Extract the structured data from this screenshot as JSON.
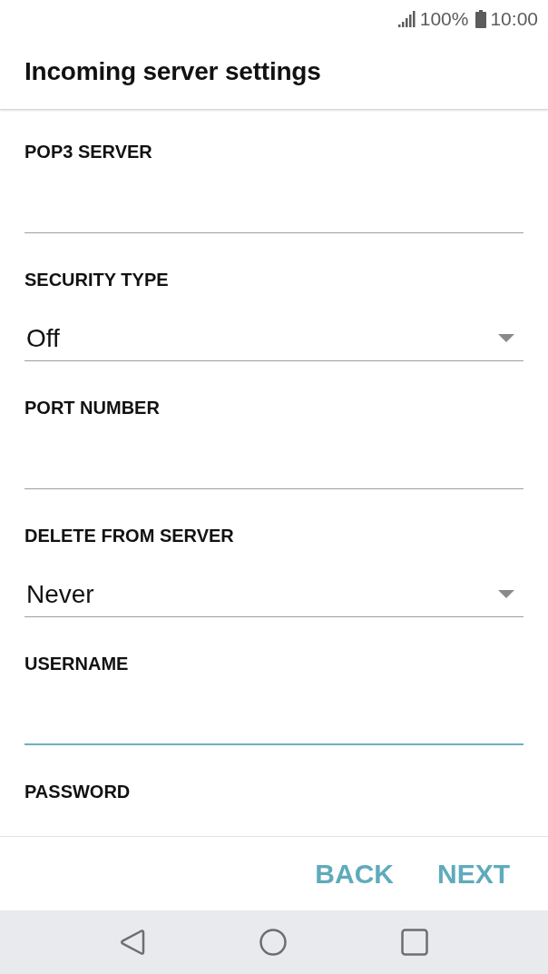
{
  "status_bar": {
    "battery_text": "100%",
    "time": "10:00"
  },
  "header": {
    "title": "Incoming server settings"
  },
  "fields": [
    {
      "kind": "text",
      "label": "POP3 SERVER",
      "focused": false
    },
    {
      "kind": "dropdown",
      "label": "SECURITY TYPE",
      "value": "Off",
      "focused": false
    },
    {
      "kind": "text",
      "label": "PORT NUMBER",
      "focused": false
    },
    {
      "kind": "dropdown",
      "label": "DELETE FROM SERVER",
      "value": "Never",
      "focused": false
    },
    {
      "kind": "text",
      "label": "USERNAME",
      "focused": true
    },
    {
      "kind": "label",
      "label": "PASSWORD"
    }
  ],
  "buttons": [
    "BACK",
    "NEXT"
  ]
}
